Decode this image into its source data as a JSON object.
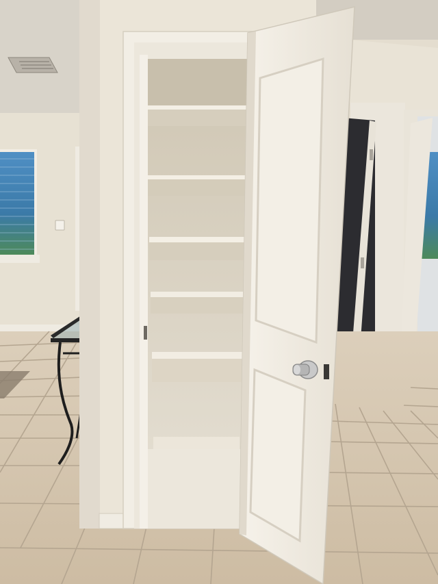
{
  "scene": {
    "subject": "open-pantry-closet",
    "shelf_count": 5,
    "colors": {
      "wall": "#e9e3d6",
      "ceiling": "#d9d4ca",
      "trim": "#f1ede4",
      "closet_interior": "#ddd6c6",
      "shelf": "#ece6da",
      "door": "#f3efe6",
      "floor_tile": "#d7c8b2",
      "grout": "#b9ab96",
      "window_glass": "#3f7fb8",
      "dark_door": "#2a2a2e",
      "doorknob": "#b7b7b7"
    },
    "icons": [
      "doorknob-icon",
      "air-vent-icon",
      "light-switch-icon",
      "hinge-icon"
    ]
  }
}
